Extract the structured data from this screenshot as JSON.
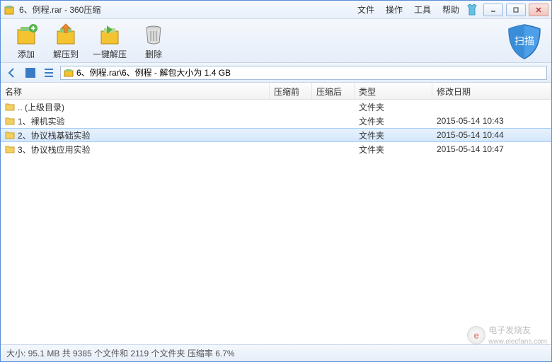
{
  "titlebar": {
    "title": "6、例程.rar - 360压缩"
  },
  "menu": {
    "file": "文件",
    "operation": "操作",
    "tools": "工具",
    "help": "帮助"
  },
  "toolbar": {
    "add": "添加",
    "extract_to": "解压到",
    "one_click": "一键解压",
    "delete": "删除",
    "scan": "扫描"
  },
  "path": "6、例程.rar\\6、例程 - 解包大小为 1.4 GB",
  "columns": {
    "name": "名称",
    "before": "压缩前",
    "after": "压缩后",
    "type": "类型",
    "date": "修改日期"
  },
  "rows": [
    {
      "name": ".. (上级目录)",
      "before": "",
      "after": "",
      "type": "文件夹",
      "date": ""
    },
    {
      "name": "1、裸机实验",
      "before": "",
      "after": "",
      "type": "文件夹",
      "date": "2015-05-14 10:43"
    },
    {
      "name": "2、协议栈基础实验",
      "before": "",
      "after": "",
      "type": "文件夹",
      "date": "2015-05-14 10:44",
      "selected": true
    },
    {
      "name": "3、协议栈应用实验",
      "before": "",
      "after": "",
      "type": "文件夹",
      "date": "2015-05-14 10:47"
    }
  ],
  "status": "大小: 95.1 MB 共 9385 个文件和 2119 个文件夹 压缩率 6.7%",
  "watermark": {
    "brand": "电子发烧友",
    "url": "www.elecfans.com",
    "badge": "e"
  }
}
